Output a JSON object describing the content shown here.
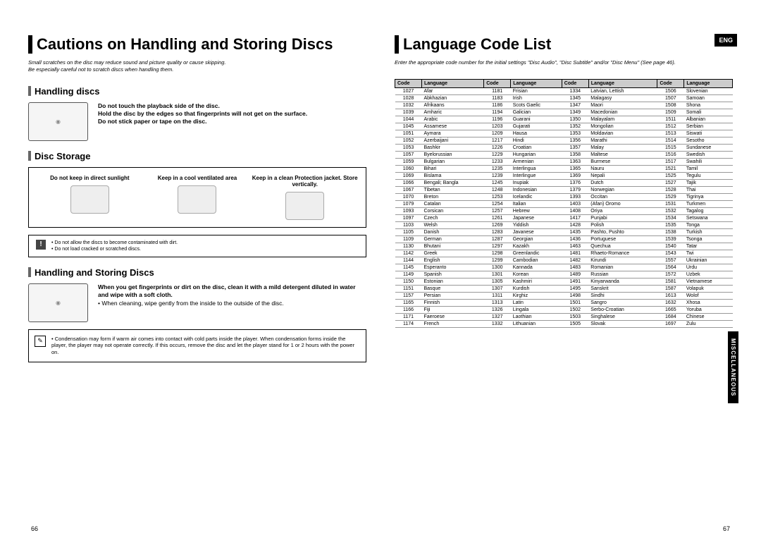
{
  "left": {
    "title": "Cautions on Handling and Storing Discs",
    "sub1": "Small scratches on the disc may reduce sound and picture quality or cause skipping.",
    "sub2": "Be especially careful not to scratch discs when handling them.",
    "h_hd": "Handling discs",
    "hd_b1": "Do not touch the playback side of the disc.",
    "hd_b2": "Hold the disc by the edges so that fingerprints will not get on the surface.",
    "hd_b3": "Do not stick paper or tape on the disc.",
    "h_ds": "Disc Storage",
    "ds1": "Do not keep in direct sunlight",
    "ds2": "Keep in a cool ventilated area",
    "ds3": "Keep in a clean Protection jacket. Store vertically.",
    "note1": "• Do not allow the discs to become contaminated with dirt.",
    "note2": "• Do not load cracked or scratched discs.",
    "h_hs": "Handling and Storing Discs",
    "hs_b": "When you get fingerprints or dirt on the disc, clean it with a mild detergent diluted in water and wipe with a soft cloth.",
    "hs_p": "• When cleaning, wipe gently from the inside to the outside of the disc.",
    "cond": "• Condensation may form if warm air comes into contact with cold parts inside the player. When condensation forms inside the player, the player may not operate correctly. If this occurs, remove the disc and let the player stand for 1 or 2 hours with the power on."
  },
  "right": {
    "title": "Language Code List",
    "sub": "Enter the appropriate code number for the initial settings \"Disc Audio\", \"Disc Subtitle\" and/or \"Disc Menu\" (See page 46).",
    "eng": "ENG",
    "tab": "MISCELLANEOUS",
    "th": [
      "Code",
      "Language",
      "Code",
      "Language",
      "Code",
      "Language",
      "Code",
      "Language"
    ],
    "rows": [
      [
        "1027",
        "Afar",
        "1181",
        "Frisian",
        "1334",
        "Latvian, Lettish",
        "1506",
        "Slovenian"
      ],
      [
        "1028",
        "Abkhazian",
        "1183",
        "Irish",
        "1345",
        "Malagasy",
        "1507",
        "Samoan"
      ],
      [
        "1032",
        "Afrikaans",
        "1186",
        "Scots Gaelic",
        "1347",
        "Maori",
        "1508",
        "Shona"
      ],
      [
        "1039",
        "Amharic",
        "1194",
        "Galician",
        "1349",
        "Macedonian",
        "1509",
        "Somali"
      ],
      [
        "1044",
        "Arabic",
        "1196",
        "Guarani",
        "1350",
        "Malayalam",
        "1511",
        "Albanian"
      ],
      [
        "1045",
        "Assamese",
        "1203",
        "Gujarati",
        "1352",
        "Mongolian",
        "1512",
        "Serbian"
      ],
      [
        "1051",
        "Aymara",
        "1209",
        "Hausa",
        "1353",
        "Moldavian",
        "1513",
        "Siswati"
      ],
      [
        "1052",
        "Azerbaijani",
        "1217",
        "Hindi",
        "1356",
        "Marathi",
        "1514",
        "Sesotho"
      ],
      [
        "1053",
        "Bashkir",
        "1226",
        "Croatian",
        "1357",
        "Malay",
        "1515",
        "Sundanese"
      ],
      [
        "1057",
        "Byelorussian",
        "1229",
        "Hungarian",
        "1358",
        "Maltese",
        "1516",
        "Swedish"
      ],
      [
        "1059",
        "Bulgarian",
        "1233",
        "Armenian",
        "1363",
        "Burmese",
        "1517",
        "Swahili"
      ],
      [
        "1060",
        "Bihari",
        "1235",
        "Interlingua",
        "1365",
        "Nauru",
        "1521",
        "Tamil"
      ],
      [
        "1069",
        "Bislama",
        "1239",
        "Interlingue",
        "1369",
        "Nepali",
        "1525",
        "Tegulu"
      ],
      [
        "1066",
        "Bengali; Bangla",
        "1245",
        "Inupiak",
        "1376",
        "Dutch",
        "1527",
        "Tajik"
      ],
      [
        "1067",
        "Tibetan",
        "1248",
        "Indonesian",
        "1379",
        "Norwegian",
        "1528",
        "Thai"
      ],
      [
        "1070",
        "Breton",
        "1253",
        "Icelandic",
        "1393",
        "Occitan",
        "1529",
        "Tigrinya"
      ],
      [
        "1079",
        "Catalan",
        "1254",
        "Italian",
        "1403",
        "(Afan) Oromo",
        "1531",
        "Turkmen"
      ],
      [
        "1093",
        "Corsican",
        "1257",
        "Hebrew",
        "1408",
        "Oriya",
        "1532",
        "Tagalog"
      ],
      [
        "1097",
        "Czech",
        "1261",
        "Japanese",
        "1417",
        "Punjabi",
        "1534",
        "Setswana"
      ],
      [
        "1103",
        "Welsh",
        "1269",
        "Yiddish",
        "1428",
        "Polish",
        "1535",
        "Tonga"
      ],
      [
        "1105",
        "Danish",
        "1283",
        "Javanese",
        "1435",
        "Pashto, Pushto",
        "1538",
        "Turkish"
      ],
      [
        "1109",
        "German",
        "1287",
        "Georgian",
        "1436",
        "Portuguese",
        "1539",
        "Tsonga"
      ],
      [
        "1130",
        "Bhutani",
        "1297",
        "Kazakh",
        "1463",
        "Quechua",
        "1540",
        "Tatar"
      ],
      [
        "1142",
        "Greek",
        "1298",
        "Greenlandic",
        "1481",
        "Rhaeto-Romance",
        "1543",
        "Twi"
      ],
      [
        "1144",
        "English",
        "1299",
        "Cambodian",
        "1482",
        "Kirundi",
        "1557",
        "Ukrainian"
      ],
      [
        "1145",
        "Esperanto",
        "1300",
        "Kannada",
        "1483",
        "Romanian",
        "1564",
        "Urdu"
      ],
      [
        "1149",
        "Spanish",
        "1301",
        "Korean",
        "1489",
        "Russian",
        "1572",
        "Uzbek"
      ],
      [
        "1150",
        "Estonian",
        "1305",
        "Kashmiri",
        "1491",
        "Kinyarwanda",
        "1581",
        "Vietnamese"
      ],
      [
        "1151",
        "Basque",
        "1307",
        "Kurdish",
        "1495",
        "Sanskrit",
        "1587",
        "Volapuk"
      ],
      [
        "1157",
        "Persian",
        "1311",
        "Kirghiz",
        "1498",
        "Sindhi",
        "1613",
        "Wolof"
      ],
      [
        "1165",
        "Finnish",
        "1313",
        "Latin",
        "1501",
        "Sangro",
        "1632",
        "Xhosa"
      ],
      [
        "1166",
        "Fiji",
        "1326",
        "Lingala",
        "1502",
        "Serbo-Croatian",
        "1665",
        "Yoruba"
      ],
      [
        "1171",
        "Faeroese",
        "1327",
        "Laothian",
        "1503",
        "Singhalese",
        "1684",
        "Chinese"
      ],
      [
        "1174",
        "French",
        "1332",
        "Lithuanian",
        "1505",
        "Slovak",
        "1697",
        "Zulu"
      ]
    ]
  },
  "pn": {
    "l": "66",
    "r": "67"
  }
}
